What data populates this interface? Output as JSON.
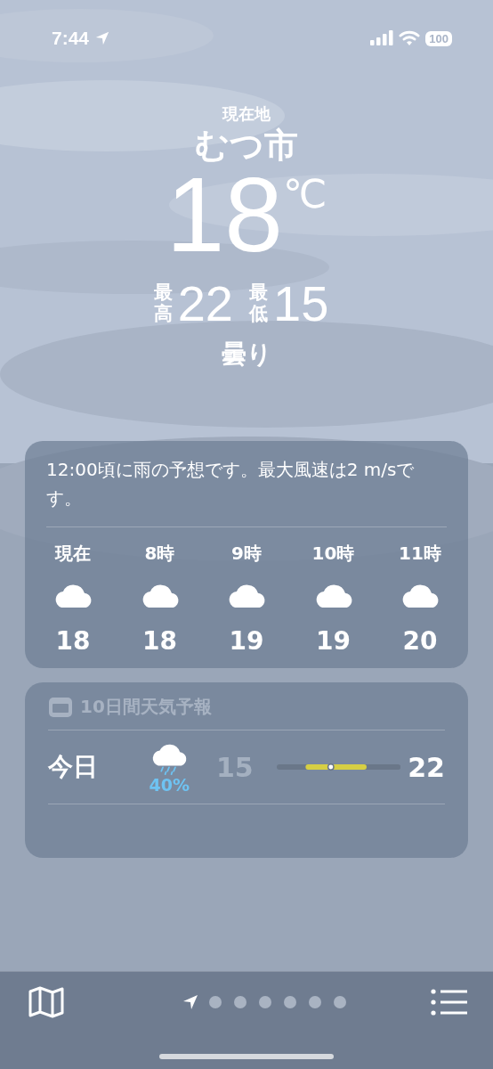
{
  "status_bar": {
    "time": "7:44",
    "battery": "100"
  },
  "header": {
    "location_label": "現在地",
    "city": "むつ市",
    "temperature": "18",
    "unit": "℃",
    "high_label": "最高",
    "high": "22",
    "low_label": "最低",
    "low": "15",
    "condition": "曇り"
  },
  "hourly": {
    "summary": "12:00頃に雨の予想です。最大風速は2 m/sです。",
    "hours": [
      {
        "label": "現在",
        "temp": "18"
      },
      {
        "label": "8時",
        "temp": "18"
      },
      {
        "label": "9時",
        "temp": "19"
      },
      {
        "label": "10時",
        "temp": "19"
      },
      {
        "label": "11時",
        "temp": "20"
      }
    ]
  },
  "daily": {
    "title": "10日間天気予報",
    "days": [
      {
        "day": "今日",
        "kind": "rain",
        "chance": "40%",
        "low": "15",
        "high": "22"
      }
    ]
  },
  "bottom_bar": {
    "pages": [
      {
        "kind": "location",
        "selected": true
      },
      {
        "kind": "dot",
        "selected": false
      },
      {
        "kind": "dot",
        "selected": false
      },
      {
        "kind": "dot",
        "selected": false
      },
      {
        "kind": "dot",
        "selected": false
      },
      {
        "kind": "dot",
        "selected": false
      },
      {
        "kind": "dot",
        "selected": false
      }
    ]
  }
}
